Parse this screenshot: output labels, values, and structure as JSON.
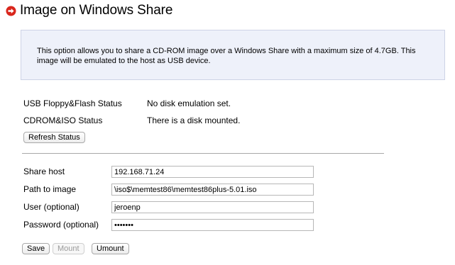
{
  "header": {
    "title": "Image on Windows Share",
    "icon": "arrow-right-circle-icon",
    "icon_color": "#d9261c"
  },
  "info": {
    "text": "This option allows you to share a CD-ROM image over a Windows Share with a maximum size of 4.7GB. This image will be emulated to the host as USB device."
  },
  "status": {
    "usb_label": "USB Floppy&Flash Status",
    "usb_value": "No disk emulation set.",
    "cdrom_label": "CDROM&ISO Status",
    "cdrom_value": "There is a disk mounted.",
    "refresh_button": "Refresh Status"
  },
  "form": {
    "share_host_label": "Share host",
    "share_host_value": "192.168.71.24",
    "path_label": "Path to image",
    "path_value": "\\iso$\\memtest86\\memtest86plus-5.01.iso",
    "user_label": "User (optional)",
    "user_value": "jeroenp",
    "password_label": "Password (optional)",
    "password_value": "•••••••"
  },
  "actions": {
    "save": "Save",
    "mount": "Mount",
    "umount": "Umount"
  },
  "colors": {
    "info_bg": "#eef1fa",
    "info_border": "#cdd3e6"
  }
}
